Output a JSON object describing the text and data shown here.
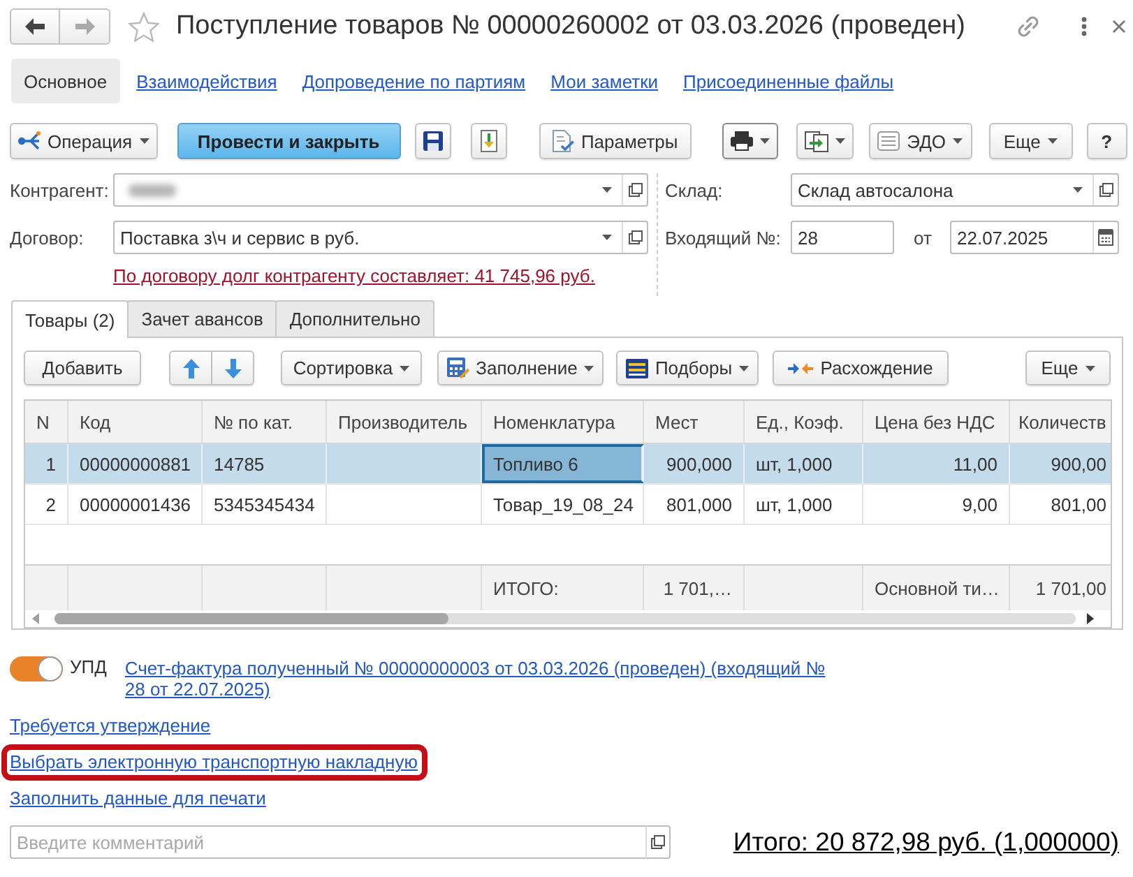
{
  "window": {
    "title": "Поступление товаров № 00000260002 от 03.03.2026 (проведен)",
    "favorite": false,
    "back_disabled": false,
    "forward_disabled": true
  },
  "sections": [
    {
      "label": "Основное",
      "selected": true
    },
    {
      "label": "Взаимодействия",
      "selected": false
    },
    {
      "label": "Допроведение по партиям",
      "selected": false
    },
    {
      "label": "Мои заметки",
      "selected": false
    },
    {
      "label": "Присоединенные файлы",
      "selected": false
    }
  ],
  "command_bar": [
    {
      "kind": "operation",
      "label": "Операция",
      "dropdown": true
    },
    {
      "kind": "primary",
      "label": "Провести и закрыть",
      "dropdown": false
    },
    {
      "kind": "save",
      "dropdown": false
    },
    {
      "kind": "post",
      "dropdown": false
    },
    {
      "kind": "settings",
      "label": "Параметры",
      "dropdown": false
    },
    {
      "kind": "print",
      "dropdown": true
    },
    {
      "kind": "exchange",
      "dropdown": true
    },
    {
      "kind": "edo",
      "label": "ЭДО",
      "dropdown": true
    },
    {
      "kind": "more",
      "label": "Еще",
      "dropdown": true
    },
    {
      "kind": "help",
      "label": "?",
      "dropdown": false
    }
  ],
  "fields": {
    "counterparty": {
      "label": "Контрагент:",
      "blurred": true
    },
    "contract": {
      "label": "Договор:",
      "value": "Поставка з\\ч и сервис в руб."
    },
    "debt_note": "По договору долг контрагенту составляет: 41 745,96 руб.",
    "warehouse": {
      "label": "Склад:",
      "value": "Склад автосалона"
    },
    "incoming": {
      "label": "Входящий №:",
      "value": "28"
    },
    "incoming_date": {
      "label": "от",
      "value": "22.07.2025"
    }
  },
  "tabs": [
    {
      "label": "Товары (2)",
      "selected": true
    },
    {
      "label": "Зачет авансов",
      "selected": false
    },
    {
      "label": "Дополнительно",
      "selected": false
    }
  ],
  "goods_toolbar": [
    {
      "kind": "add",
      "label": "Добавить",
      "dropdown": false
    },
    {
      "kind": "up",
      "dropdown": false
    },
    {
      "kind": "down",
      "dropdown": false
    },
    {
      "kind": "sort",
      "label": "Сортировка",
      "dropdown": true
    },
    {
      "kind": "fill",
      "label": "Заполнение",
      "dropdown": true
    },
    {
      "kind": "pick",
      "label": "Подборы",
      "dropdown": true
    },
    {
      "kind": "diff",
      "label": "Расхождение",
      "dropdown": false
    },
    {
      "kind": "more",
      "label": "Еще",
      "dropdown": true
    }
  ],
  "table": {
    "columns": [
      "N",
      "Код",
      "№ по кат.",
      "Производитель",
      "Номенклатура",
      "Мест",
      "Ед., Коэф.",
      "Цена без НДС",
      "Количеств"
    ],
    "rows": [
      {
        "selected": true,
        "cells": [
          {
            "text": "1",
            "focused": false
          },
          {
            "text": "00000000881",
            "focused": false
          },
          {
            "text": "14785",
            "focused": false
          },
          {
            "focused": false
          },
          {
            "text": "Топливо 6",
            "focused": true
          },
          {
            "text": "900,000",
            "focused": false
          },
          {
            "text": "шт, 1,000",
            "focused": false
          },
          {
            "text": "11,00",
            "focused": false
          },
          {
            "text": "900,00",
            "focused": false
          }
        ]
      },
      {
        "selected": false,
        "cells": [
          {
            "text": "2",
            "focused": false
          },
          {
            "text": "00000001436",
            "focused": false
          },
          {
            "text": "5345345434",
            "focused": false
          },
          {
            "focused": false
          },
          {
            "text": "Товар_19_08_24",
            "focused": false
          },
          {
            "text": "801,000",
            "focused": false
          },
          {
            "text": "шт, 1,000",
            "focused": false
          },
          {
            "text": "9,00",
            "focused": false
          },
          {
            "text": "801,00",
            "focused": false
          }
        ]
      }
    ],
    "totals": {
      "nomenclature": "ИТОГО:",
      "places": "1 701,…",
      "price_without_vat": "Основной ти…",
      "quantity": "1 701,00"
    }
  },
  "upd": {
    "label": "УПД",
    "on": true,
    "link": "Счет-фактура полученный № 00000000003 от 03.03.2026 (проведен) (входящий № 28 от 22.07.2025)"
  },
  "links": [
    {
      "label": "Требуется утверждение",
      "highlighted": false
    },
    {
      "label": "Выбрать электронную транспортную накладную",
      "highlighted": true
    },
    {
      "label": "Заполнить данные для печати",
      "highlighted": false
    }
  ],
  "comment": {
    "placeholder": "Введите комментарий"
  },
  "total": "Итого: 20 872,98 руб. (1,000000)"
}
